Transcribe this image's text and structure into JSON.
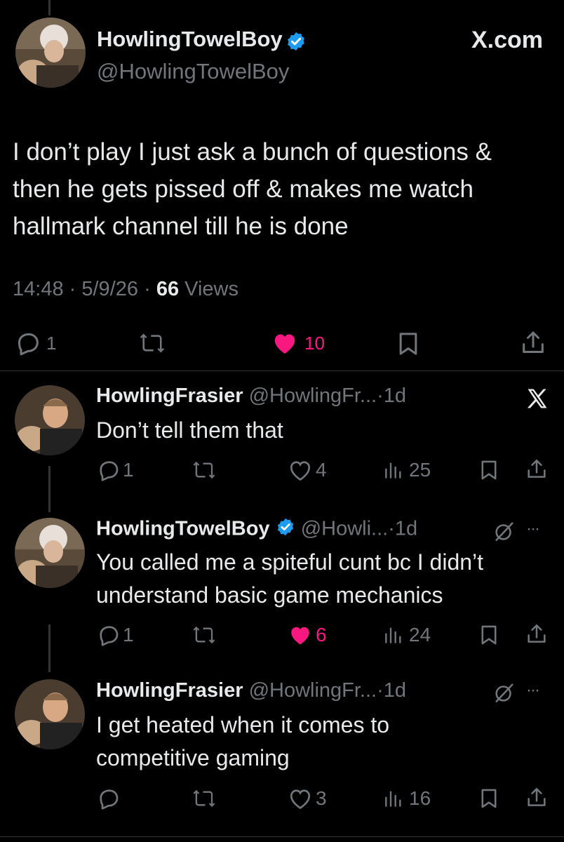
{
  "header": {
    "display_name": "HowlingTowelBoy",
    "handle": "@HowlingTowelBoy",
    "brand": "X.com"
  },
  "main_tweet": {
    "text_lines": [
      "I don’t play I just ask a bunch of questions &",
      "then he gets pissed off & makes me watch",
      "hallmark channel till he is done"
    ],
    "time": "14:48",
    "date": "5/9/26",
    "views_count": "66",
    "views_label": "Views",
    "replies": "1",
    "likes": "10"
  },
  "replies": [
    {
      "name": "HowlingFrasier",
      "handle": "@HowlingFr...",
      "age": "1d",
      "text": "Don’t tell them that",
      "replies": "1",
      "likes": "4",
      "views": "25"
    },
    {
      "name": "HowlingTowelBoy",
      "handle": "@Howli...",
      "age": "1d",
      "text_lines": [
        "You called me a spiteful cunt bc I didn’t",
        "understand basic game mechanics"
      ],
      "replies": "1",
      "likes": "6",
      "views": "24"
    },
    {
      "name": "HowlingFrasier",
      "handle": "@HowlingFr...",
      "age": "1d",
      "text_lines": [
        "I get heated when it comes to",
        "competitive gaming"
      ],
      "likes": "3",
      "views": "16"
    }
  ],
  "separator": "·",
  "ellipsis": "···",
  "colors": {
    "background": "#000000",
    "text": "#e7e9ea",
    "muted": "#71767b",
    "like": "#f91880",
    "verified": "#1d9bf0"
  }
}
